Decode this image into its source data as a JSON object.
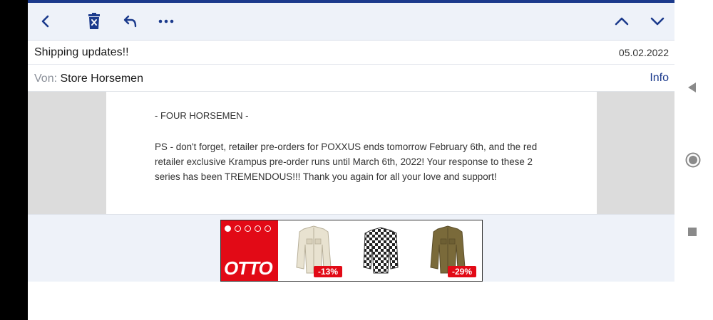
{
  "toolbar": {
    "icons": [
      "back-icon",
      "delete-icon",
      "reply-icon",
      "more-icon",
      "previous-icon",
      "next-icon"
    ],
    "accent": "#1b3a8c"
  },
  "email": {
    "subject": "Shipping updates!!",
    "date": "05.02.2022",
    "from_label": "Von:",
    "from_name": "Store Horsemen",
    "info_label": "Info"
  },
  "body": {
    "signature": "- FOUR HORSEMEN -",
    "paragraph": "PS - don't forget, retailer pre-orders for POXXUS ends tomorrow February 6th, and the red retailer exclusive Krampus pre-order runs until March 6th, 2022! Your response to these 2 series has been TREMENDOUS!!! Thank you again for all your love and support!"
  },
  "ad": {
    "brand": "OTTO",
    "brand_color": "#e20a16",
    "products": [
      {
        "name": "cream-jacket",
        "discount": "-13%"
      },
      {
        "name": "checked-shirt",
        "discount": ""
      },
      {
        "name": "olive-jacket",
        "discount": "-29%"
      }
    ]
  },
  "system_nav": {
    "icons": [
      "back-triangle-icon",
      "home-circle-icon",
      "recents-square-icon"
    ]
  }
}
